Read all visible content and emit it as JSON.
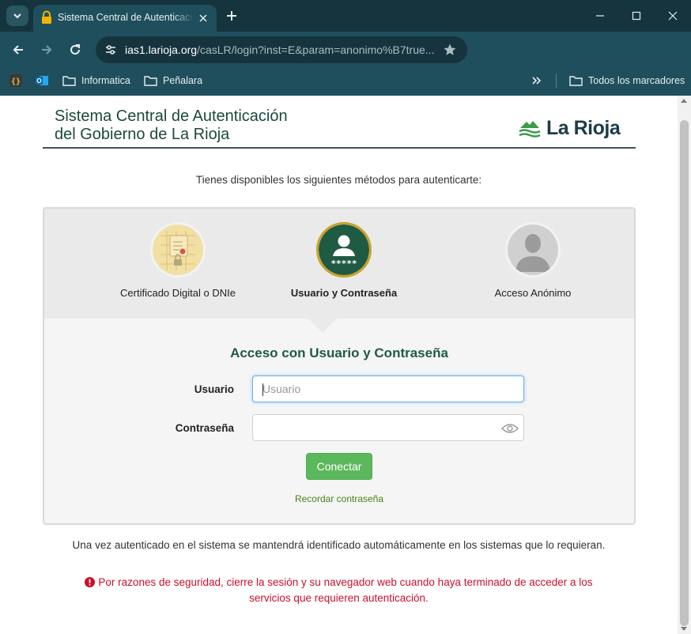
{
  "browser": {
    "tab_title": "Sistema Central de Autenticación",
    "url_host": "ias1.larioja.org",
    "url_path": "/casLR/login?inst=E&param=anonimo%B7true...",
    "bookmarks": [
      "Informatica",
      "Peñalara"
    ],
    "all_bookmarks_label": "Todos los marcadores"
  },
  "header": {
    "title_line1": "Sistema Central de Autenticación",
    "title_line2": "del Gobierno de La Rioja",
    "logo_text": "La Rioja"
  },
  "intro_text": "Tienes disponibles los siguientes métodos para autenticarte:",
  "methods": [
    {
      "label": "Certificado Digital o DNIe",
      "active": false
    },
    {
      "label": "Usuario y Contraseña",
      "active": true,
      "badge": "*****"
    },
    {
      "label": "Acceso Anónimo",
      "active": false
    }
  ],
  "form": {
    "title": "Acceso con Usuario y Contraseña",
    "user_label": "Usuario",
    "user_placeholder": "Usuario",
    "user_value": "",
    "password_label": "Contraseña",
    "password_value": "",
    "submit_label": "Conectar",
    "remember_link": "Recordar contraseña"
  },
  "after_note": "Una vez autenticado en el sistema se mantendrá identificado automáticamente en los sistemas que lo requieran.",
  "warning": {
    "line1": "Por razones de seguridad, cierre la sesión y su navegador web cuando haya terminado de acceder a los",
    "line2": "servicios que requieren autenticación."
  },
  "colors": {
    "chrome_bg": "#1f4f5c",
    "tabstrip_bg": "#15343e",
    "accent_green": "#1f5a43",
    "button_green": "#5cb85c",
    "warning_red": "#c9102c",
    "active_ring": "#c9a227"
  }
}
